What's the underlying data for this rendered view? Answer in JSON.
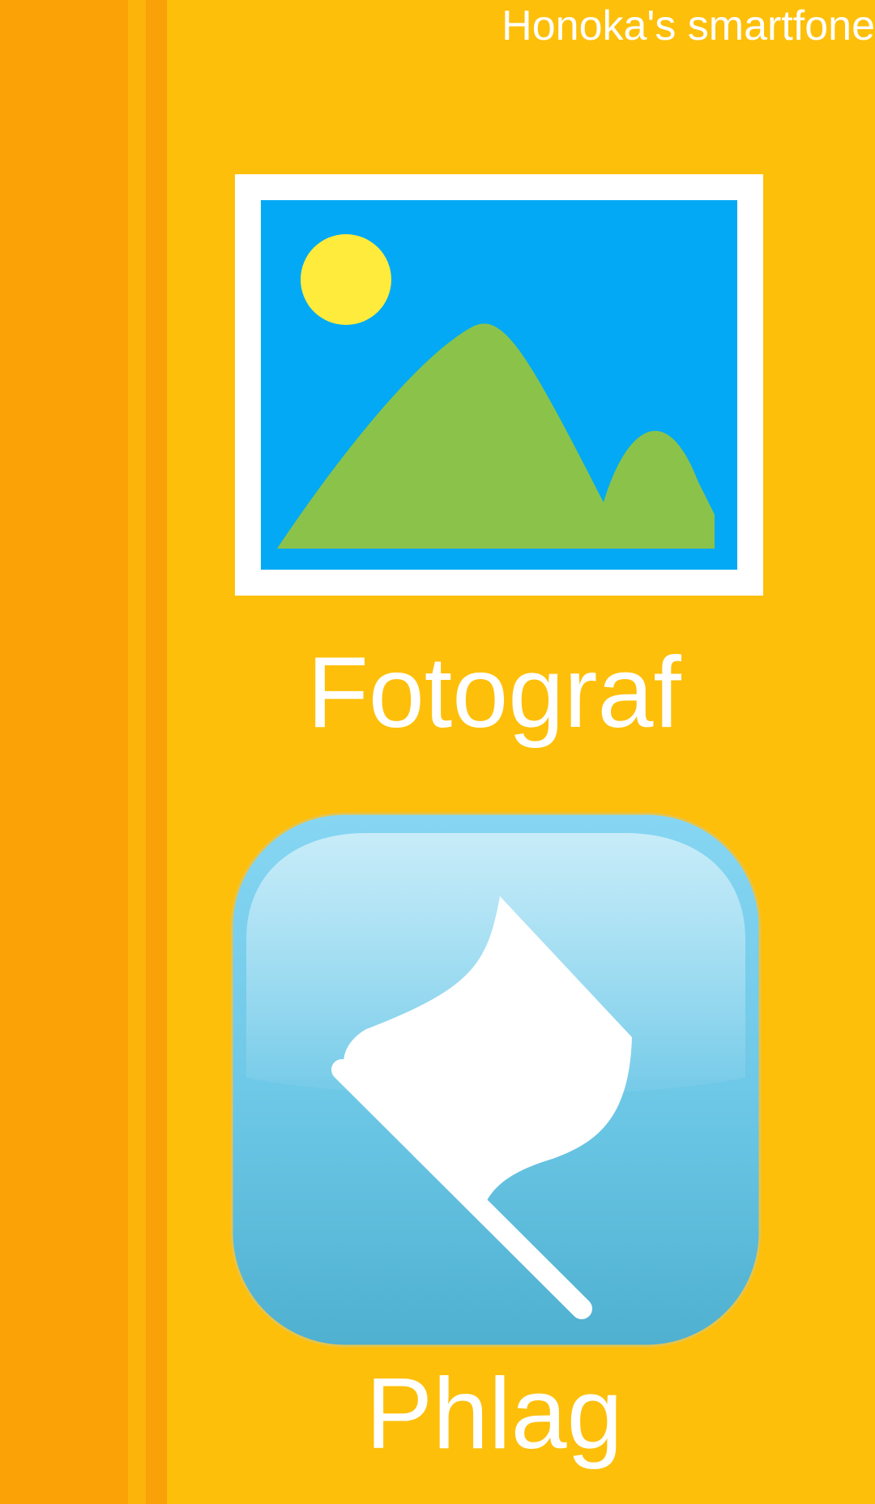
{
  "status_bar": {
    "owner_label": "Honoka's smartfone"
  },
  "apps": [
    {
      "label": "Fotograf",
      "icon": "photo-landscape-icon"
    },
    {
      "label": "Phlag",
      "icon": "flag-icon"
    }
  ],
  "colors": {
    "background": "#FDBF0A",
    "left_band": "#FBA207",
    "photo_sky": "#03A9F4",
    "photo_sun": "#FFEB3B",
    "photo_hills": "#8BC34A",
    "flag_tile": "#5BC0DE"
  }
}
